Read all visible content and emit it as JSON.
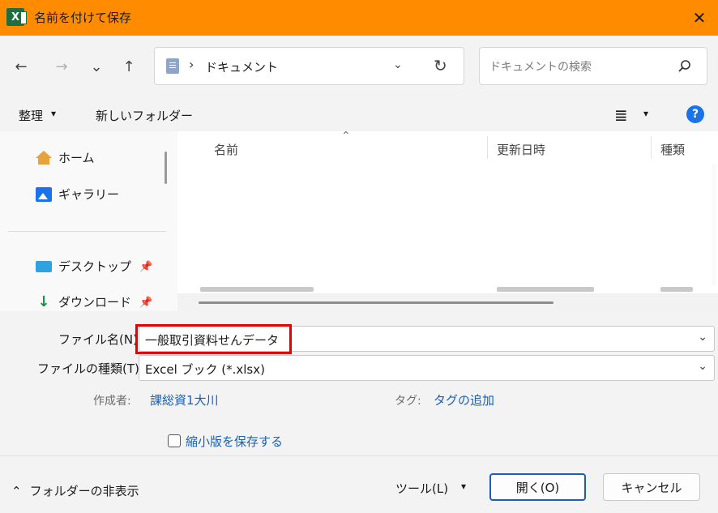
{
  "window": {
    "title": "名前を付けて保存",
    "close_glyph": "✕",
    "app_icon_letter": "X"
  },
  "nav": {
    "back_glyph": "←",
    "forward_glyph": "→",
    "recent_glyph": "⌄",
    "up_glyph": "↑",
    "address_sep": "›",
    "address_location": "ドキュメント",
    "address_chevron": "⌄",
    "refresh_glyph": "↻",
    "search_placeholder": "ドキュメントの検索"
  },
  "toolbar": {
    "organize_label": "整理",
    "caret": "▾",
    "new_folder_label": "新しいフォルダー",
    "view_glyph": "≣",
    "help_glyph": "?"
  },
  "sidebar": {
    "items": [
      {
        "label": "ホーム",
        "icon": "home-icon"
      },
      {
        "label": "ギャラリー",
        "icon": "gallery-icon"
      },
      {
        "label": "デスクトップ",
        "icon": "desktop-icon",
        "pinned": true
      },
      {
        "label": "ダウンロード",
        "icon": "download-icon",
        "pinned": true
      }
    ],
    "pin_glyph": "📌"
  },
  "filelist": {
    "columns": [
      "名前",
      "更新日時",
      "種類"
    ],
    "sort_glyph": "⌃"
  },
  "form": {
    "filename_label": "ファイル名(N):",
    "filename_value": "一般取引資料せんデータ",
    "filetype_label": "ファイルの種類(T):",
    "filetype_value": "Excel ブック (*.xlsx)",
    "chevron": "⌄",
    "author_label": "作成者:",
    "author_value": "課総資1大川",
    "tags_label": "タグ:",
    "tags_value": "タグの追加",
    "thumbnail_label": "縮小版を保存する"
  },
  "footer": {
    "hide_folders_glyph": "⌃",
    "hide_folders_label": "フォルダーの非表示",
    "tools_label": "ツール(L)",
    "tools_caret": "▾",
    "open_label": "開く(O)",
    "cancel_label": "キャンセル"
  },
  "colors": {
    "titlebar": "#ff8c00",
    "highlight": "#e60000",
    "link": "#1a5fb4"
  }
}
